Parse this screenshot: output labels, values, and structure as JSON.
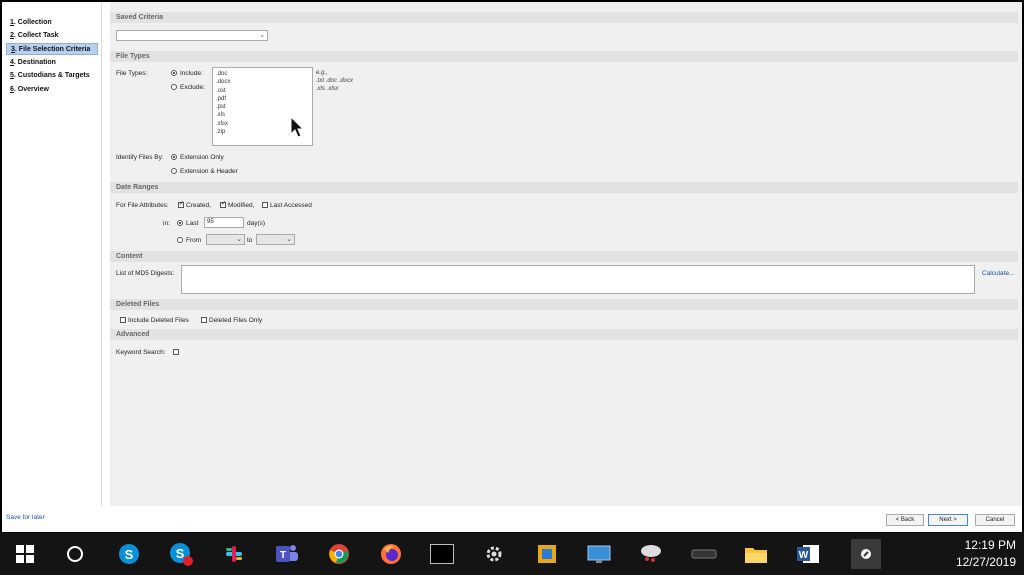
{
  "sidebar": {
    "items": [
      {
        "num": "1",
        "label": ". Collection"
      },
      {
        "num": "2",
        "label": ". Collect Task"
      },
      {
        "num": "3",
        "label": ". File Selection Criteria"
      },
      {
        "num": "4",
        "label": ". Destination"
      },
      {
        "num": "5",
        "label": ". Custodians & Targets"
      },
      {
        "num": "6",
        "label": ". Overview"
      }
    ],
    "save_for_later": "Save for later"
  },
  "sections": {
    "saved_criteria": "Saved Criteria",
    "file_types": "File Types",
    "date_ranges": "Date Ranges",
    "content": "Content",
    "deleted_files": "Deleted Files",
    "advanced": "Advanced"
  },
  "file_types": {
    "label": "File Types:",
    "include": "Include:",
    "exclude": "Exclude:",
    "list": [
      ".doc",
      ".docx",
      ".ost",
      ".pdf",
      ".pst",
      ".xls",
      ".xlsx",
      ".zip"
    ],
    "hint": [
      "e.g.,",
      ".txt .doc .docx",
      ".xls .xlsx"
    ],
    "identify_label": "Identify Files By:",
    "extension_only": "Extension Only",
    "extension_header": "Extension & Header"
  },
  "date_ranges": {
    "attrs_label": "For File Attributes:",
    "created": "Created,",
    "modified": "Modified,",
    "last_accessed": "Last Accessed",
    "in_label": "in:",
    "last": "Last",
    "last_value": "95",
    "days": "day(s)",
    "from": "From",
    "to": "to"
  },
  "content": {
    "md5_label": "List of MD5 Digests:",
    "calculate": "Calculate..."
  },
  "deleted_files": {
    "include": "Include Deleted Files",
    "only": "Deleted Files Only"
  },
  "advanced": {
    "keyword_label": "Keyword Search:"
  },
  "buttons": {
    "back": "< Back",
    "next": "Next >",
    "cancel": "Cancel"
  },
  "taskbar": {
    "icons": [
      "windows-start-icon",
      "cortana-icon",
      "skype-icon",
      "skype-business-icon",
      "slack-icon",
      "teams-icon",
      "chrome-icon",
      "firefox-icon",
      "terminal-icon",
      "settings-icon",
      "app-icon",
      "remote-desktop-icon",
      "network-icon",
      "keyboard-device-icon",
      "file-explorer-icon",
      "word-icon",
      "active-app-icon"
    ],
    "time": "12:19 PM",
    "date": "12/27/2019"
  }
}
